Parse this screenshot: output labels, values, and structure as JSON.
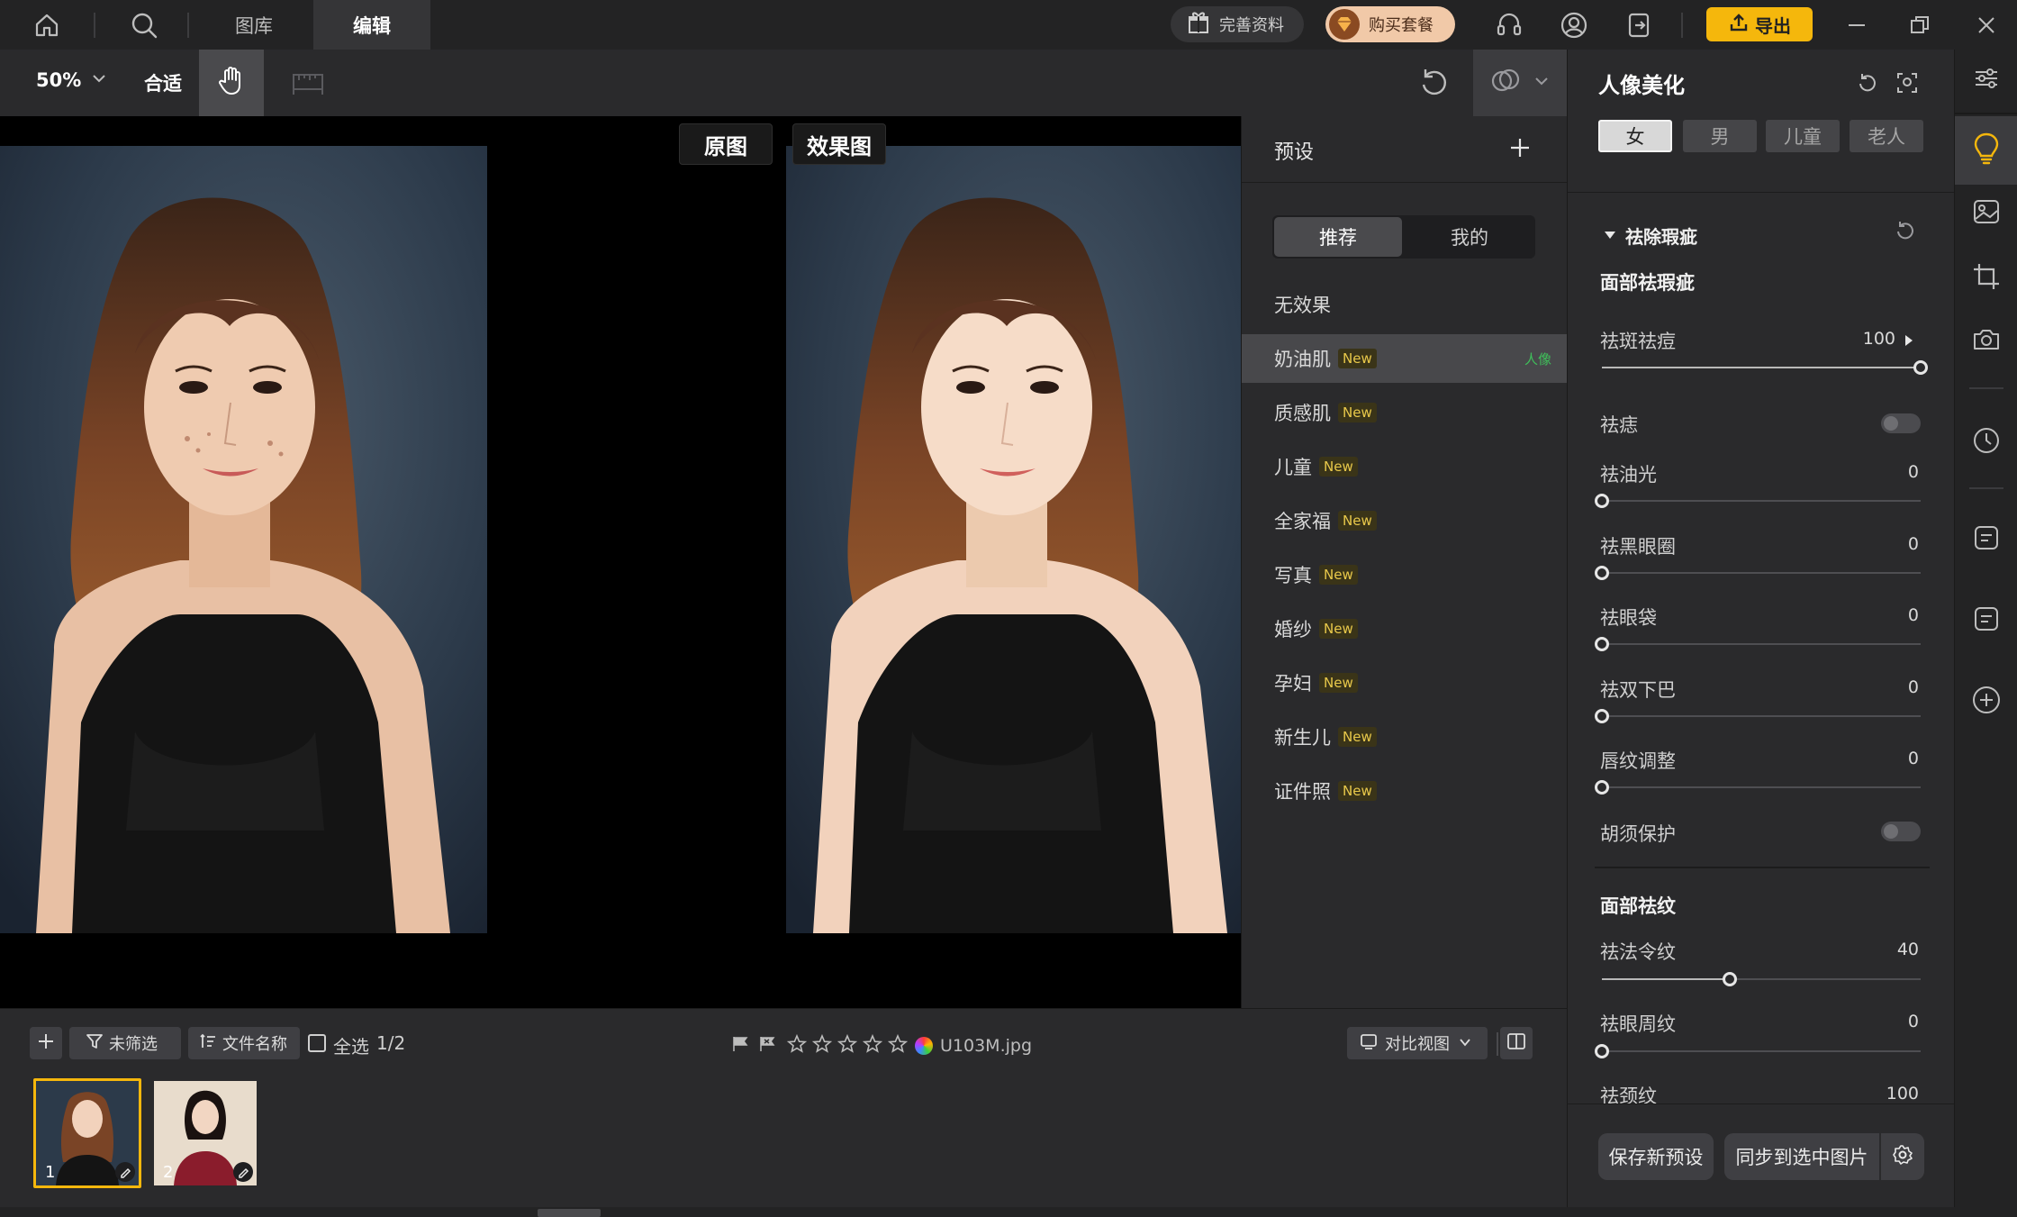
{
  "titlebar": {
    "tabs": [
      "图库",
      "编辑"
    ],
    "perfect_info": "完善资料",
    "buy_package": "购买套餐",
    "export": "导出"
  },
  "toolbar": {
    "zoom": "50%",
    "fit": "合适"
  },
  "canvas": {
    "label_original": "原图",
    "label_effect": "效果图"
  },
  "preset_panel": {
    "title": "预设",
    "tabs": [
      "推荐",
      "我的"
    ],
    "items": [
      {
        "label": "无效果",
        "tag": ""
      },
      {
        "label": "奶油肌",
        "tag": "New",
        "badge": "人像"
      },
      {
        "label": "质感肌",
        "tag": "New"
      },
      {
        "label": "儿童",
        "tag": "New"
      },
      {
        "label": "全家福",
        "tag": "New"
      },
      {
        "label": "写真",
        "tag": "New"
      },
      {
        "label": "婚纱",
        "tag": "New"
      },
      {
        "label": "孕妇",
        "tag": "New"
      },
      {
        "label": "新生儿",
        "tag": "New"
      },
      {
        "label": "证件照",
        "tag": "New"
      }
    ]
  },
  "right_panel": {
    "title": "人像美化",
    "gender_tabs": [
      "女",
      "男",
      "儿童",
      "老人"
    ],
    "section_blemish": "祛除瑕疵",
    "group_face_blemish": "面部祛瑕疵",
    "sliders_blemish": [
      {
        "label": "祛斑祛痘",
        "value": 100
      },
      {
        "label": "祛痣",
        "toggle": true
      },
      {
        "label": "祛油光",
        "value": 0
      },
      {
        "label": "祛黑眼圈",
        "value": 0
      },
      {
        "label": "祛眼袋",
        "value": 0
      },
      {
        "label": "祛双下巴",
        "value": 0
      },
      {
        "label": "唇纹调整",
        "value": 0
      },
      {
        "label": "胡须保护",
        "toggle": true
      }
    ],
    "group_face_wrinkle": "面部祛纹",
    "sliders_wrinkle": [
      {
        "label": "祛法令纹",
        "value": 40
      },
      {
        "label": "祛眼周纹",
        "value": 0
      },
      {
        "label": "祛颈纹",
        "value": 100
      }
    ],
    "save_preset": "保存新预设",
    "sync": "同步到选中图片"
  },
  "bottombar": {
    "filter": "未筛选",
    "sort": "文件名称",
    "select_all": "全选",
    "count": "1/2",
    "filename": "U103M.jpg",
    "compare_view": "对比视图"
  },
  "filmstrip": {
    "thumbs": [
      "1",
      "2"
    ]
  },
  "colors": {
    "accent": "#f5b70c",
    "new_tag": "#e8c84a",
    "portrait_badge": "#3fbf5a"
  }
}
